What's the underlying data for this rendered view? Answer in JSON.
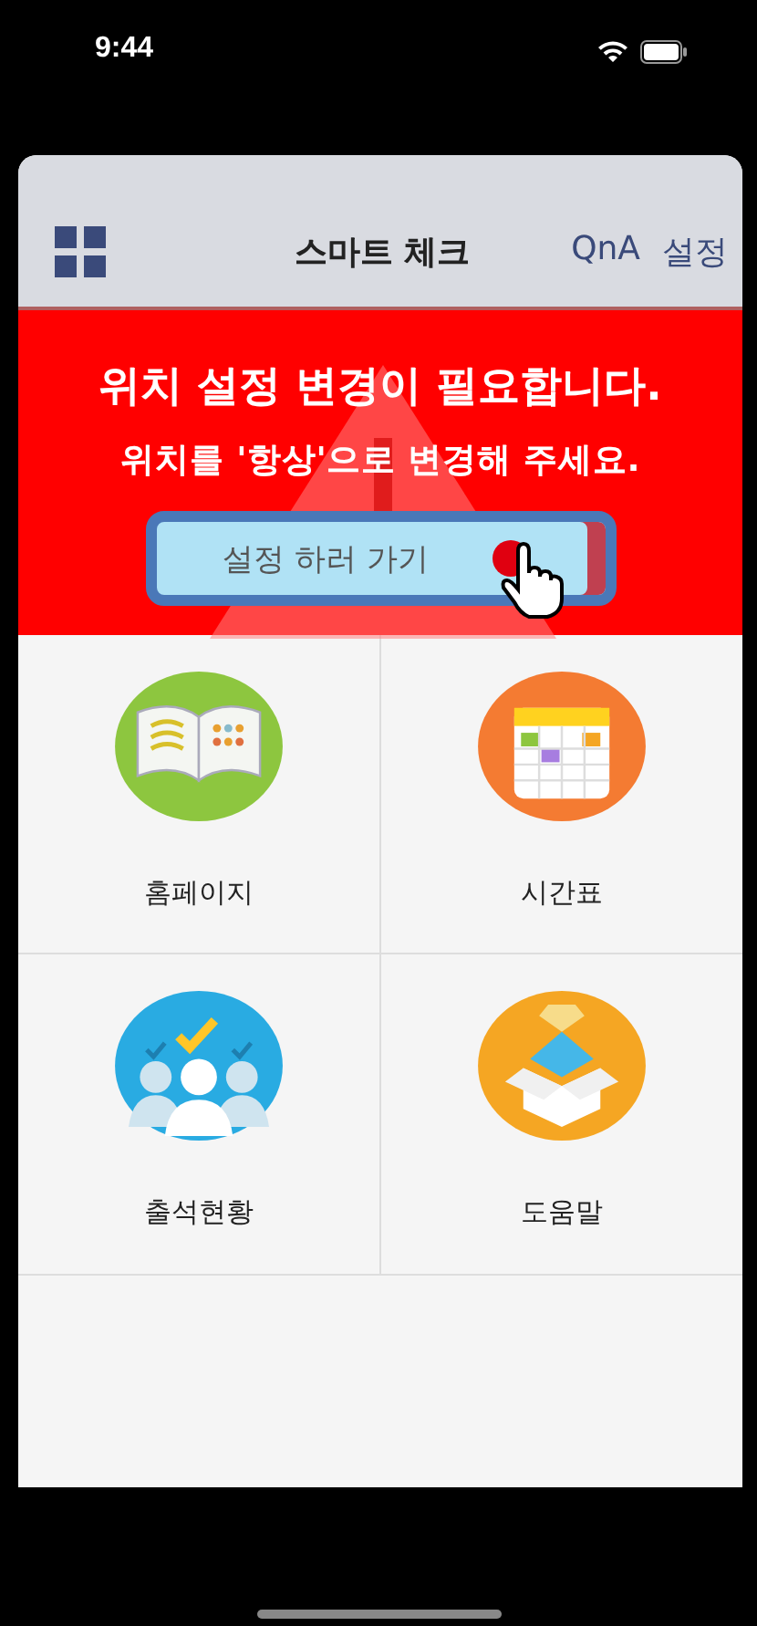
{
  "status_bar": {
    "time": "9:44"
  },
  "header": {
    "title": "스마트 체크",
    "links": [
      "QnA",
      "설정"
    ]
  },
  "alert": {
    "title": "위치 설정 변경이 필요합니다.",
    "message": "위치를 '항상'으로 변경해 주세요.",
    "button": "설정 하러 가기"
  },
  "menu": [
    {
      "label": "홈페이지",
      "kind": "book",
      "color": "#8dc63f"
    },
    {
      "label": "시간표",
      "kind": "calendar",
      "color": "#f47b32"
    },
    {
      "label": "출석현황",
      "kind": "people",
      "color": "#29abe2"
    },
    {
      "label": "도움말",
      "kind": "box",
      "color": "#f5a623"
    }
  ]
}
